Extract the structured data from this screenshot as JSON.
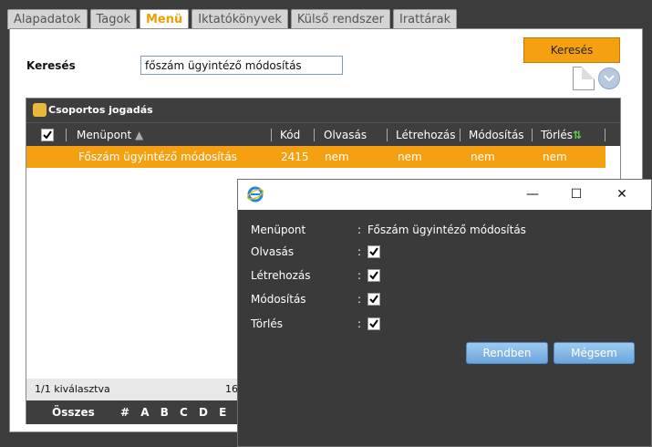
{
  "tabs": [
    {
      "label": "Alapadatok"
    },
    {
      "label": "Tagok"
    },
    {
      "label": "Menü"
    },
    {
      "label": "Iktatókönyvek"
    },
    {
      "label": "Külső rendszer"
    },
    {
      "label": "Irattárak"
    }
  ],
  "search": {
    "label": "Keresés",
    "value": "főszám ügyintéző módosítás",
    "button_label": "Keresés"
  },
  "grid": {
    "title": "Csoportos jogadás",
    "columns": [
      "Menüpont",
      "Kód",
      "Olvasás",
      "Létrehozás",
      "Módosítás",
      "Törlés"
    ],
    "rows": [
      {
        "menupont": "Főszám ügyintéző módosítás",
        "kod": "2415",
        "olvasas": "nem",
        "letrehozas": "nem",
        "modositas": "nem",
        "torles": "nem"
      }
    ],
    "footer_selected": "1/1 kiválasztva",
    "footer_count": "16",
    "alpha_all": "Összes",
    "alpha_letters": "# A B C D E F"
  },
  "dialog": {
    "min_label": "—",
    "max_label": "☐",
    "close_label": "✕",
    "fields": [
      {
        "label": "Menüpont",
        "colon": ":",
        "value": "Főszám ügyintéző módosítás"
      },
      {
        "label": "Olvasás",
        "colon": ":",
        "checked": true
      },
      {
        "label": "Létrehozás",
        "colon": ":",
        "checked": true
      },
      {
        "label": "Módosítás",
        "colon": ":",
        "checked": true
      },
      {
        "label": "Törlés",
        "colon": ":",
        "checked": true
      }
    ],
    "ok_label": "Rendben",
    "cancel_label": "Mégsem"
  },
  "colors": {
    "accent": "#f5a010",
    "header_dark": "#3e3e3e",
    "dialog_bg": "#3a3a3a",
    "button_blue": "#6aa6dc"
  }
}
